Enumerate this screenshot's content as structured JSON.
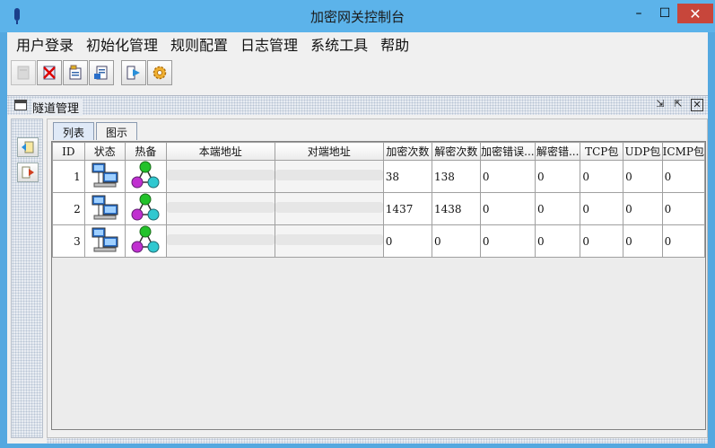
{
  "window": {
    "title": "加密网关控制台",
    "minimize": "–",
    "maximize": "☐",
    "close": "✕"
  },
  "menu": [
    "用户登录",
    "初始化管理",
    "规则配置",
    "日志管理",
    "系统工具",
    "帮助"
  ],
  "toolbar": [
    {
      "icon": "disabled-doc-icon",
      "enabled": false
    },
    {
      "icon": "cancel-doc-icon",
      "enabled": true
    },
    {
      "icon": "config-doc-icon",
      "enabled": true
    },
    {
      "icon": "export-doc-icon",
      "enabled": true
    },
    {
      "icon": "forward-arrow-icon",
      "enabled": true
    },
    {
      "icon": "gear-icon",
      "enabled": true
    }
  ],
  "panel": {
    "title": "隧道管理"
  },
  "side_buttons": [
    "import-icon",
    "export-icon"
  ],
  "tabs": [
    {
      "label": "列表",
      "active": true
    },
    {
      "label": "图示",
      "active": false
    }
  ],
  "table": {
    "columns": [
      "ID",
      "状态",
      "热备",
      "本端地址",
      "对端地址",
      "加密次数",
      "解密次数",
      "加密错误...",
      "解密错...",
      "TCP包",
      "UDP包",
      "ICMP包"
    ],
    "rows": [
      {
        "id": "1",
        "enc": "38",
        "dec": "138",
        "enc_err": "0",
        "dec_err": "0",
        "tcp": "0",
        "udp": "0",
        "icmp": "0"
      },
      {
        "id": "2",
        "enc": "1437",
        "dec": "1438",
        "enc_err": "0",
        "dec_err": "0",
        "tcp": "0",
        "udp": "0",
        "icmp": "0"
      },
      {
        "id": "3",
        "enc": "0",
        "dec": "0",
        "enc_err": "0",
        "dec_err": "0",
        "tcp": "0",
        "udp": "0",
        "icmp": "0"
      }
    ]
  },
  "colors": {
    "titlebar": "#5cb3ea",
    "close": "#c7463b",
    "tab_active": "#dfe9f7"
  }
}
